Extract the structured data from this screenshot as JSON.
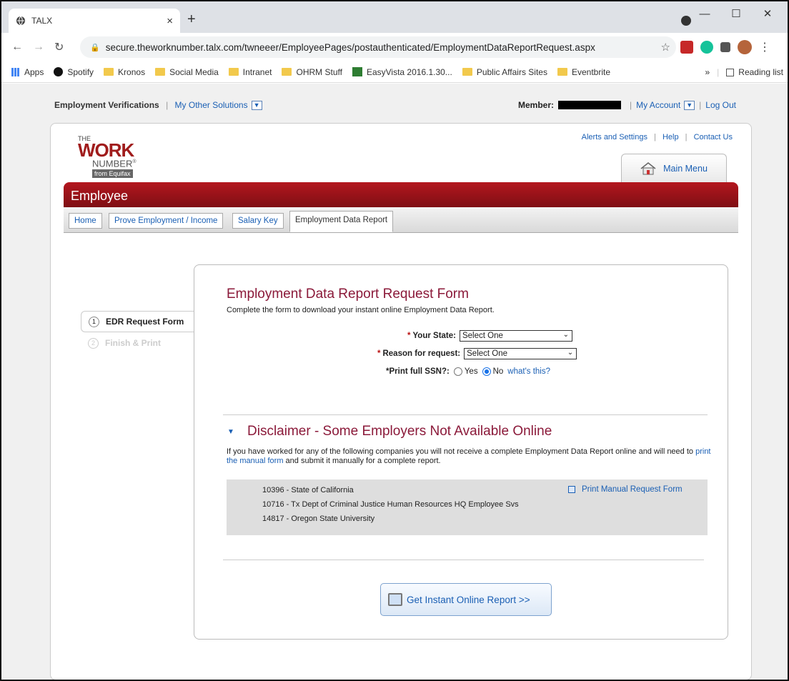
{
  "browser": {
    "tab_title": "TALX",
    "url": "secure.theworknumber.talx.com/twneeer/EmployeePages/postauthenticated/EmploymentDataReportRequest.aspx",
    "bookmarks": [
      "Apps",
      "Spotify",
      "Kronos",
      "Social Media",
      "Intranet",
      "OHRM Stuff",
      "EasyVista 2016.1.30...",
      "Public Affairs Sites",
      "Eventbrite"
    ],
    "reading_list": "Reading list",
    "overflow": "»"
  },
  "header": {
    "employment_verifications": "Employment Verifications",
    "my_other_solutions": "My Other Solutions",
    "member_label": "Member:",
    "my_account": "My Account",
    "log_out": "Log Out"
  },
  "logo": {
    "the": "THE",
    "work": "WORK",
    "number": "NUMBER",
    "registered": "®",
    "from": "from Equifax"
  },
  "top_links": {
    "alerts": "Alerts and Settings",
    "help": "Help",
    "contact": "Contact Us",
    "sep": "|"
  },
  "main_menu": "Main Menu",
  "banner": "Employee",
  "tabs": [
    "Home",
    "Prove Employment / Income",
    "Salary Key",
    "Employment Data Report"
  ],
  "steps": [
    {
      "num": "1",
      "label": "EDR Request Form"
    },
    {
      "num": "2",
      "label": "Finish & Print"
    }
  ],
  "form": {
    "title": "Employment Data Report Request Form",
    "subtitle": "Complete the form to download your instant online Employment Data Report.",
    "state_label": "Your State:",
    "state_value": "Select One",
    "reason_label": "Reason for request:",
    "reason_value": "Select One",
    "ssn_label": "*Print full SSN?:",
    "yes": "Yes",
    "no": "No",
    "whats_this": "what's this?",
    "req": "*"
  },
  "disclaimer": {
    "title": "Disclaimer - Some Employers Not Available Online",
    "text_before": "If you have worked for any of the following companies you will not receive a complete Employment Data Report online and will need to",
    "link": "print the manual form",
    "text_after": "and submit it manually for a complete report.",
    "employers": [
      "10396 - State of California",
      "10716 - Tx Dept of Criminal Justice Human Resources HQ Employee Svs",
      "14817 - Oregon State University"
    ],
    "print_manual": "Print Manual Request Form"
  },
  "get_report": "Get Instant Online Report >>"
}
